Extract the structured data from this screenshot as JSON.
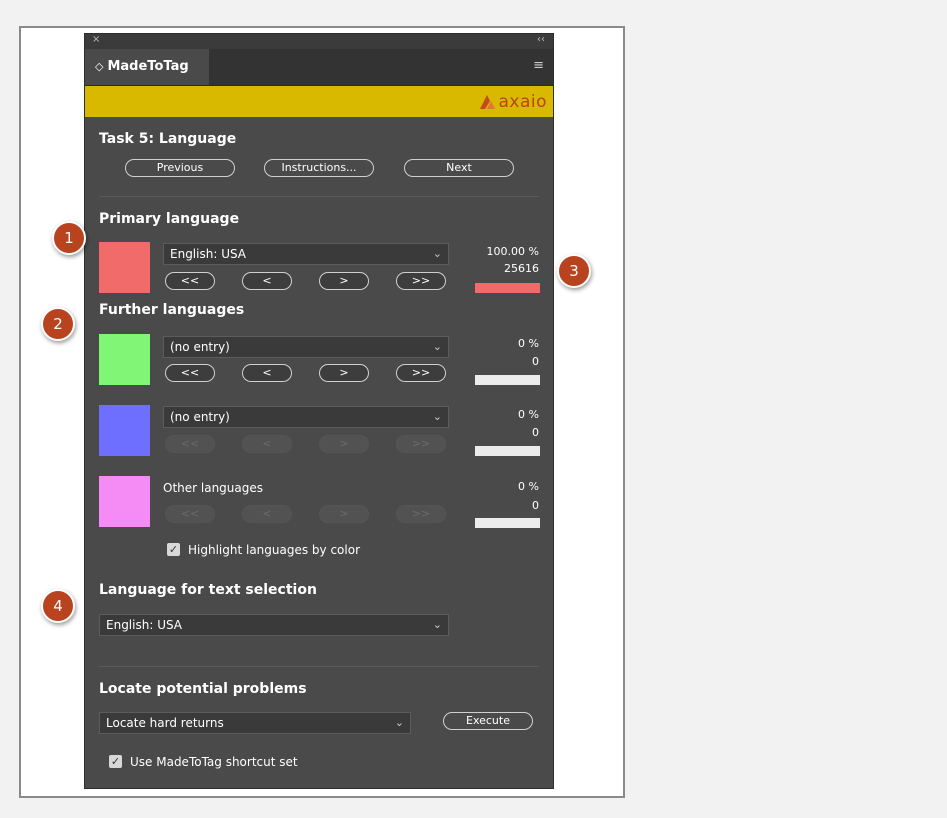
{
  "window": {
    "close": "×",
    "collapse": "‹‹"
  },
  "tab": {
    "arrow": "◇",
    "title": "MadeToTag",
    "menu": "≡"
  },
  "brand": {
    "logo_text": "axaio",
    "color": "#d9b800"
  },
  "task": {
    "title": "Task 5: Language",
    "previous": "Previous",
    "instructions": "Instructions...",
    "next": "Next"
  },
  "primary": {
    "heading": "Primary language",
    "language": "English: USA",
    "percent": "100.00 %",
    "count": "25616",
    "color": "#f26b6b",
    "nav": [
      "<<",
      "<",
      ">",
      ">>"
    ]
  },
  "further": {
    "heading": "Further languages",
    "items": [
      {
        "language": "(no entry)",
        "percent": "0 %",
        "count": "0",
        "color": "#80f576",
        "nav": [
          "<<",
          "<",
          ">",
          ">>"
        ],
        "enabled": true
      },
      {
        "language": "(no entry)",
        "percent": "0 %",
        "count": "0",
        "color": "#6f6fff",
        "nav": [
          "<<",
          "<",
          ">",
          ">>"
        ],
        "enabled": false
      }
    ],
    "other": {
      "label": "Other languages",
      "percent": "0 %",
      "count": "0",
      "color": "#f58cf5",
      "nav": [
        "<<",
        "<",
        ">",
        ">>"
      ]
    },
    "highlight_label": "Highlight languages by color",
    "highlight_checked": true
  },
  "selection": {
    "heading": "Language for text selection",
    "language": "English: USA"
  },
  "problems": {
    "heading": "Locate potential problems",
    "option": "Locate hard returns",
    "execute": "Execute",
    "shortcut_label": "Use MadeToTag shortcut set",
    "shortcut_checked": true
  },
  "callouts": [
    "1",
    "2",
    "3",
    "4"
  ]
}
